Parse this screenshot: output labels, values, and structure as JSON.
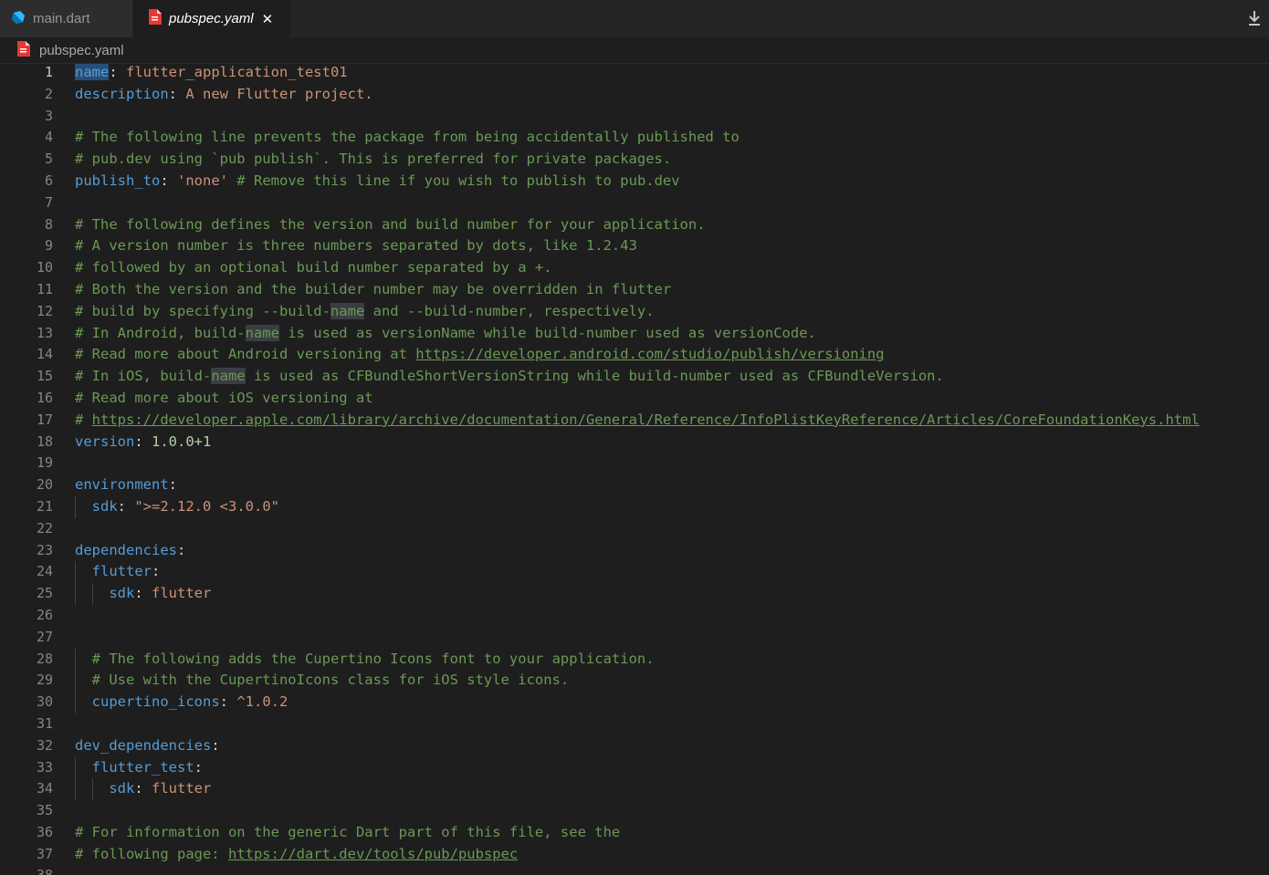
{
  "tabs": [
    {
      "label": "main.dart",
      "active": false,
      "icon": "dart-icon"
    },
    {
      "label": "pubspec.yaml",
      "active": true,
      "icon": "yaml-file-icon"
    }
  ],
  "tab_close_glyph": "✕",
  "breadcrumb": {
    "label": "pubspec.yaml"
  },
  "current_line": 1,
  "lines": [
    [
      [
        "k",
        "name",
        "hl"
      ],
      [
        "p",
        ": "
      ],
      [
        "s",
        "flutter_application_test01"
      ]
    ],
    [
      [
        "k",
        "description"
      ],
      [
        "p",
        ": "
      ],
      [
        "s",
        "A new Flutter project."
      ]
    ],
    [],
    [
      [
        "c",
        "# The following line prevents the package from being accidentally published to"
      ]
    ],
    [
      [
        "c",
        "# pub.dev using `pub publish`. This is preferred for private packages."
      ]
    ],
    [
      [
        "k",
        "publish_to"
      ],
      [
        "p",
        ": "
      ],
      [
        "s",
        "'none'"
      ],
      [
        "p",
        " "
      ],
      [
        "c",
        "# Remove this line if you wish to publish to pub.dev"
      ]
    ],
    [],
    [
      [
        "c",
        "# The following defines the version and build number for your application."
      ]
    ],
    [
      [
        "c",
        "# A version number is three numbers separated by dots, like 1.2.43"
      ]
    ],
    [
      [
        "c",
        "# followed by an optional build number separated by a +."
      ]
    ],
    [
      [
        "c",
        "# Both the version and the builder number may be overridden in flutter"
      ]
    ],
    [
      [
        "c",
        "# build by specifying --build-"
      ],
      [
        "c",
        "name",
        "hl2"
      ],
      [
        "c",
        " and --build-number, respectively."
      ]
    ],
    [
      [
        "c",
        "# In Android, build-"
      ],
      [
        "c",
        "name",
        "hl2"
      ],
      [
        "c",
        " is used as versionName while build-number used as versionCode."
      ]
    ],
    [
      [
        "c",
        "# Read more about Android versioning at "
      ],
      [
        "u",
        "https://developer.android.com/studio/publish/versioning"
      ]
    ],
    [
      [
        "c",
        "# In iOS, build-"
      ],
      [
        "c",
        "name",
        "hl2"
      ],
      [
        "c",
        " is used as CFBundleShortVersionString while build-number used as CFBundleVersion."
      ]
    ],
    [
      [
        "c",
        "# Read more about iOS versioning at"
      ]
    ],
    [
      [
        "c",
        "# "
      ],
      [
        "u",
        "https://developer.apple.com/library/archive/documentation/General/Reference/InfoPlistKeyReference/Articles/CoreFoundationKeys.html"
      ]
    ],
    [
      [
        "k",
        "version"
      ],
      [
        "p",
        ": "
      ],
      [
        "n",
        "1.0.0+1"
      ]
    ],
    [],
    [
      [
        "k",
        "environment"
      ],
      [
        "p",
        ":"
      ]
    ],
    [
      [
        "p",
        "  "
      ],
      [
        "k",
        "sdk"
      ],
      [
        "p",
        ": "
      ],
      [
        "s",
        "\">=2.12.0 <3.0.0\""
      ]
    ],
    [],
    [
      [
        "k",
        "dependencies"
      ],
      [
        "p",
        ":"
      ]
    ],
    [
      [
        "p",
        "  "
      ],
      [
        "k",
        "flutter"
      ],
      [
        "p",
        ":"
      ]
    ],
    [
      [
        "p",
        "    "
      ],
      [
        "k",
        "sdk"
      ],
      [
        "p",
        ": "
      ],
      [
        "s",
        "flutter"
      ]
    ],
    [],
    [],
    [
      [
        "p",
        "  "
      ],
      [
        "c",
        "# The following adds the Cupertino Icons font to your application."
      ]
    ],
    [
      [
        "p",
        "  "
      ],
      [
        "c",
        "# Use with the CupertinoIcons class for iOS style icons."
      ]
    ],
    [
      [
        "p",
        "  "
      ],
      [
        "k",
        "cupertino_icons"
      ],
      [
        "p",
        ": "
      ],
      [
        "s",
        "^1.0.2"
      ]
    ],
    [],
    [
      [
        "k",
        "dev_dependencies"
      ],
      [
        "p",
        ":"
      ]
    ],
    [
      [
        "p",
        "  "
      ],
      [
        "k",
        "flutter_test"
      ],
      [
        "p",
        ":"
      ]
    ],
    [
      [
        "p",
        "    "
      ],
      [
        "k",
        "sdk"
      ],
      [
        "p",
        ": "
      ],
      [
        "s",
        "flutter"
      ]
    ],
    [],
    [
      [
        "c",
        "# For information on the generic Dart part of this file, see the"
      ]
    ],
    [
      [
        "c",
        "# following page: "
      ],
      [
        "u",
        "https://dart.dev/tools/pub/pubspec"
      ]
    ],
    []
  ]
}
